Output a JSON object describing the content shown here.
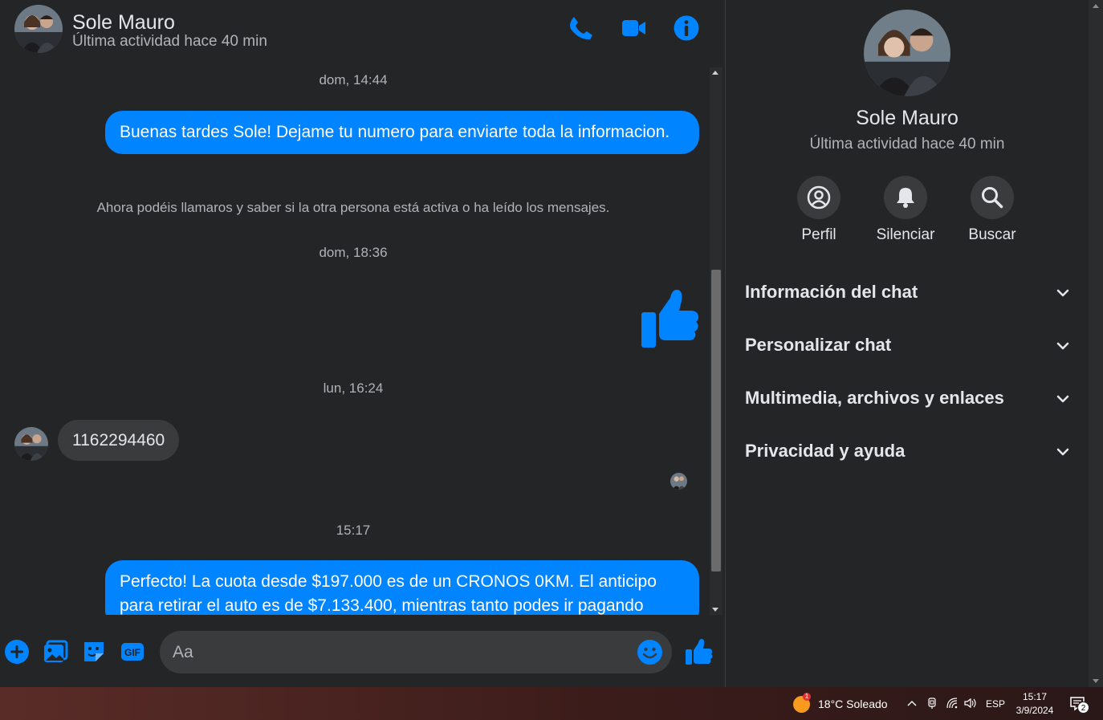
{
  "header": {
    "name": "Sole Mauro",
    "status": "Última actividad hace 40 min"
  },
  "messages": {
    "ts1": "dom, 14:44",
    "msg1": "Buenas tardes Sole! Dejame tu numero para enviarte toda la informacion.",
    "notice": "Ahora podéis llamaros y saber si la otra persona está activa o ha leído los mensajes.",
    "ts2": "dom, 18:36",
    "ts3": "lun, 16:24",
    "incoming": "1162294460",
    "ts4": "15:17",
    "msg2": "Perfecto! La cuota desde $197.000 es de un CRONOS 0KM. El anticipo para retirar el auto es de $7.133.400, mientras tanto podes ir pagando"
  },
  "composer": {
    "placeholder": "Aa"
  },
  "panel": {
    "name": "Sole Mauro",
    "status": "Última actividad hace 40 min",
    "actions": [
      {
        "label": "Perfil",
        "icon": "profile-icon"
      },
      {
        "label": "Silenciar",
        "icon": "bell-icon"
      },
      {
        "label": "Buscar",
        "icon": "search-icon"
      }
    ],
    "sections": [
      "Información del chat",
      "Personalizar chat",
      "Multimedia, archivos y enlaces",
      "Privacidad y ayuda"
    ]
  },
  "taskbar": {
    "weather": "18°C  Soleado",
    "weather_badge": "1",
    "lang": "ESP",
    "time": "15:17",
    "date": "3/9/2024",
    "notifications": "2"
  },
  "colors": {
    "accent": "#0084ff",
    "background": "#242526",
    "bubble_in": "#3a3b3c"
  }
}
